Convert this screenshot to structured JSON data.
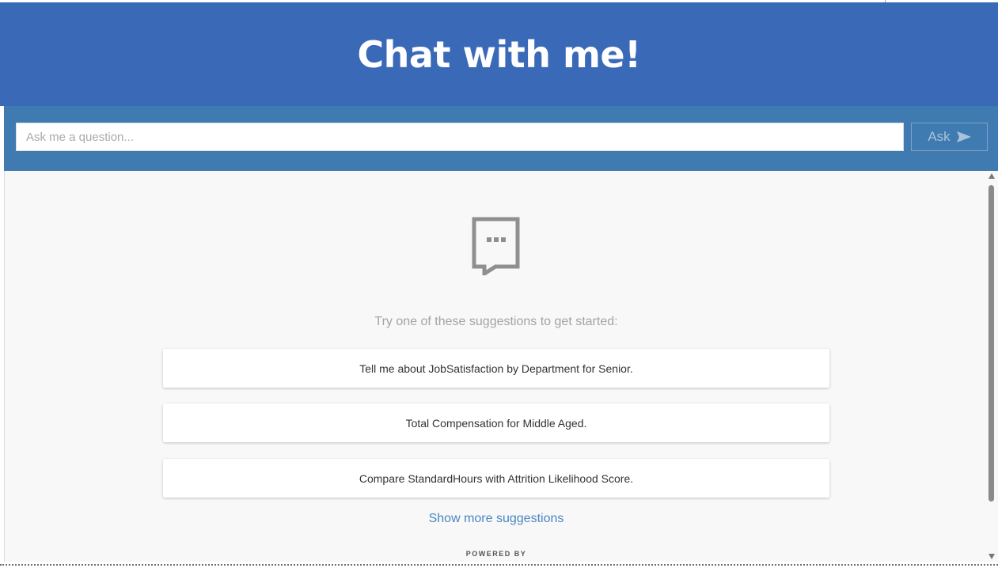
{
  "header": {
    "title": "Chat with me!"
  },
  "ask_bar": {
    "placeholder": "Ask me a question...",
    "value": "",
    "button_label": "Ask",
    "button_icon": "send-arrow-icon"
  },
  "empty_state": {
    "icon": "chat-bubble-icon",
    "prompt": "Try one of these suggestions to get started:",
    "suggestions": [
      "Tell me about JobSatisfaction by Department for Senior.",
      "Total Compensation for Middle Aged.",
      "Compare StandardHours with Attrition Likelihood Score."
    ],
    "more_link": "Show more suggestions",
    "footer": "POWERED BY"
  },
  "colors": {
    "header_bg": "#3a69b8",
    "askbar_bg": "#3f7bb0",
    "panel_bg": "#f8f8f8",
    "link": "#4a86c1"
  }
}
